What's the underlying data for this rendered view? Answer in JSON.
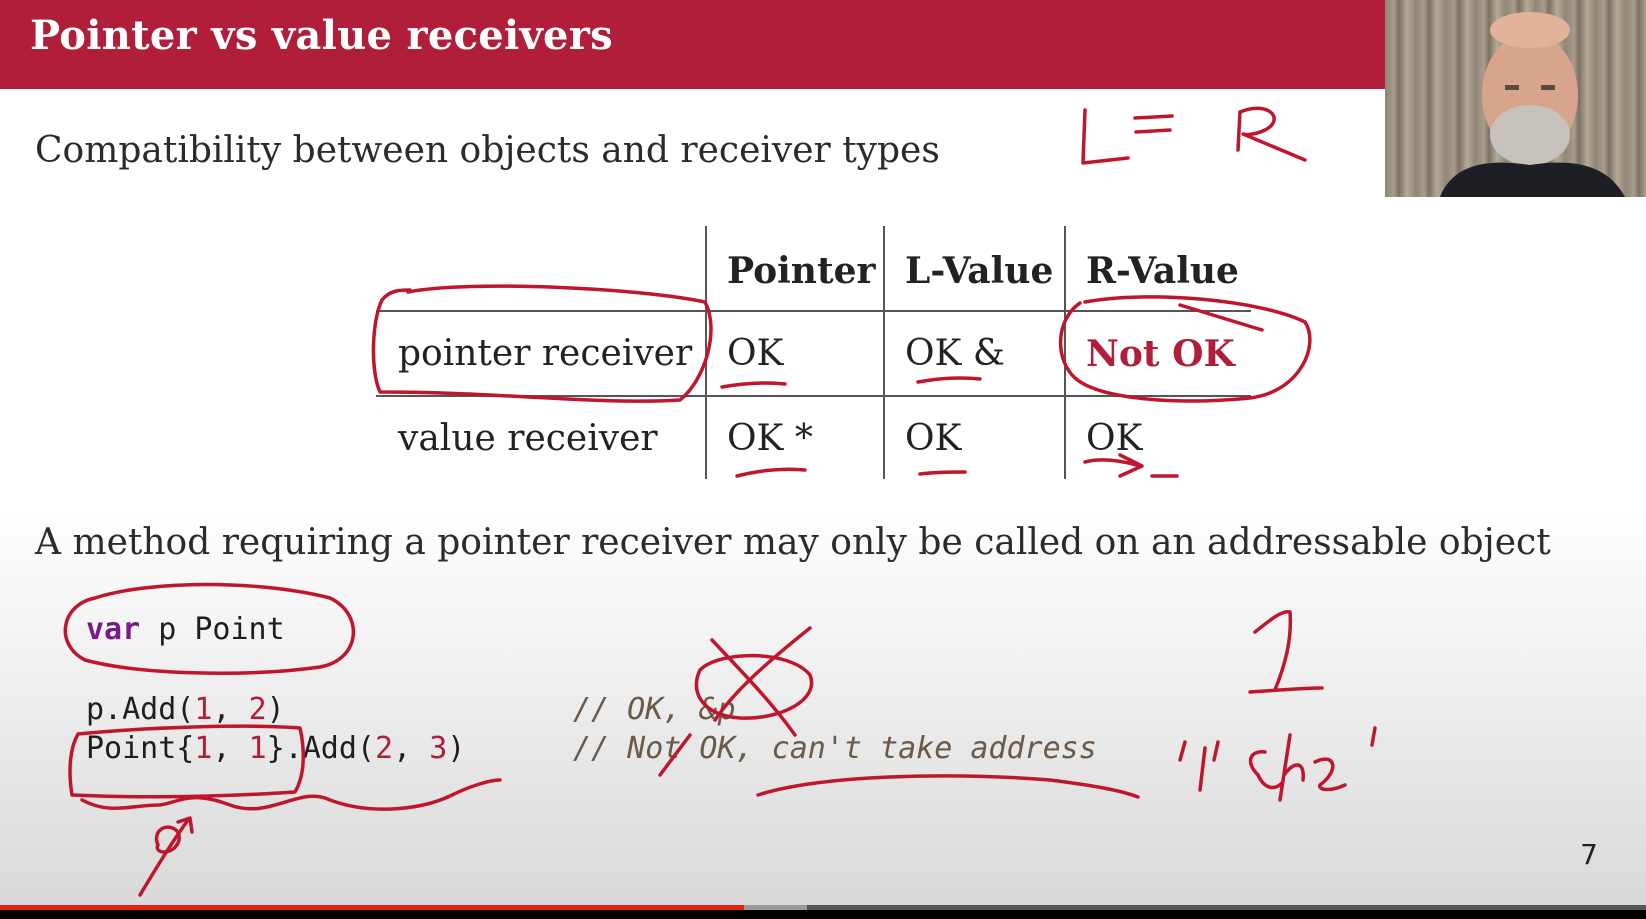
{
  "slide": {
    "title": "Pointer vs value receivers",
    "subtitle": "Compatibility between objects and receiver types",
    "statement": "A method requiring a pointer receiver may only be called on an addressable object",
    "page_number": "7"
  },
  "table": {
    "headers": [
      "Pointer",
      "L-Value",
      "R-Value"
    ],
    "rows": [
      {
        "label": "pointer receiver",
        "cells": [
          "OK",
          "OK &",
          "Not OK"
        ]
      },
      {
        "label": "value receiver",
        "cells": [
          "OK *",
          "OK",
          "OK"
        ]
      }
    ]
  },
  "code": {
    "line1": {
      "kw": "var",
      "rest": " p Point"
    },
    "line2": {
      "a": "p.Add(",
      "n1": "1",
      "b": ", ",
      "n2": "2",
      "c": ")"
    },
    "line2_comment": "// OK, &p",
    "line3": {
      "a": "Point{",
      "n1": "1",
      "b": ", ",
      "n2": "1",
      "c": "}.Add(",
      "n3": "2",
      "d": ", ",
      "n4": "3",
      "e": ")"
    },
    "line3_comment": "// Not OK, can't take address"
  },
  "annotations": {
    "lr": "L = R",
    "one": "1",
    "char_literal": "'1' 'c' 'h' 'e'"
  },
  "video": {
    "progress": 0.452,
    "buffered": 0.49
  },
  "colors": {
    "title_bar": "#b01e3a",
    "accent_red": "#b01e3a",
    "ink": "#c0162d",
    "keyword": "#7a1a8a"
  }
}
